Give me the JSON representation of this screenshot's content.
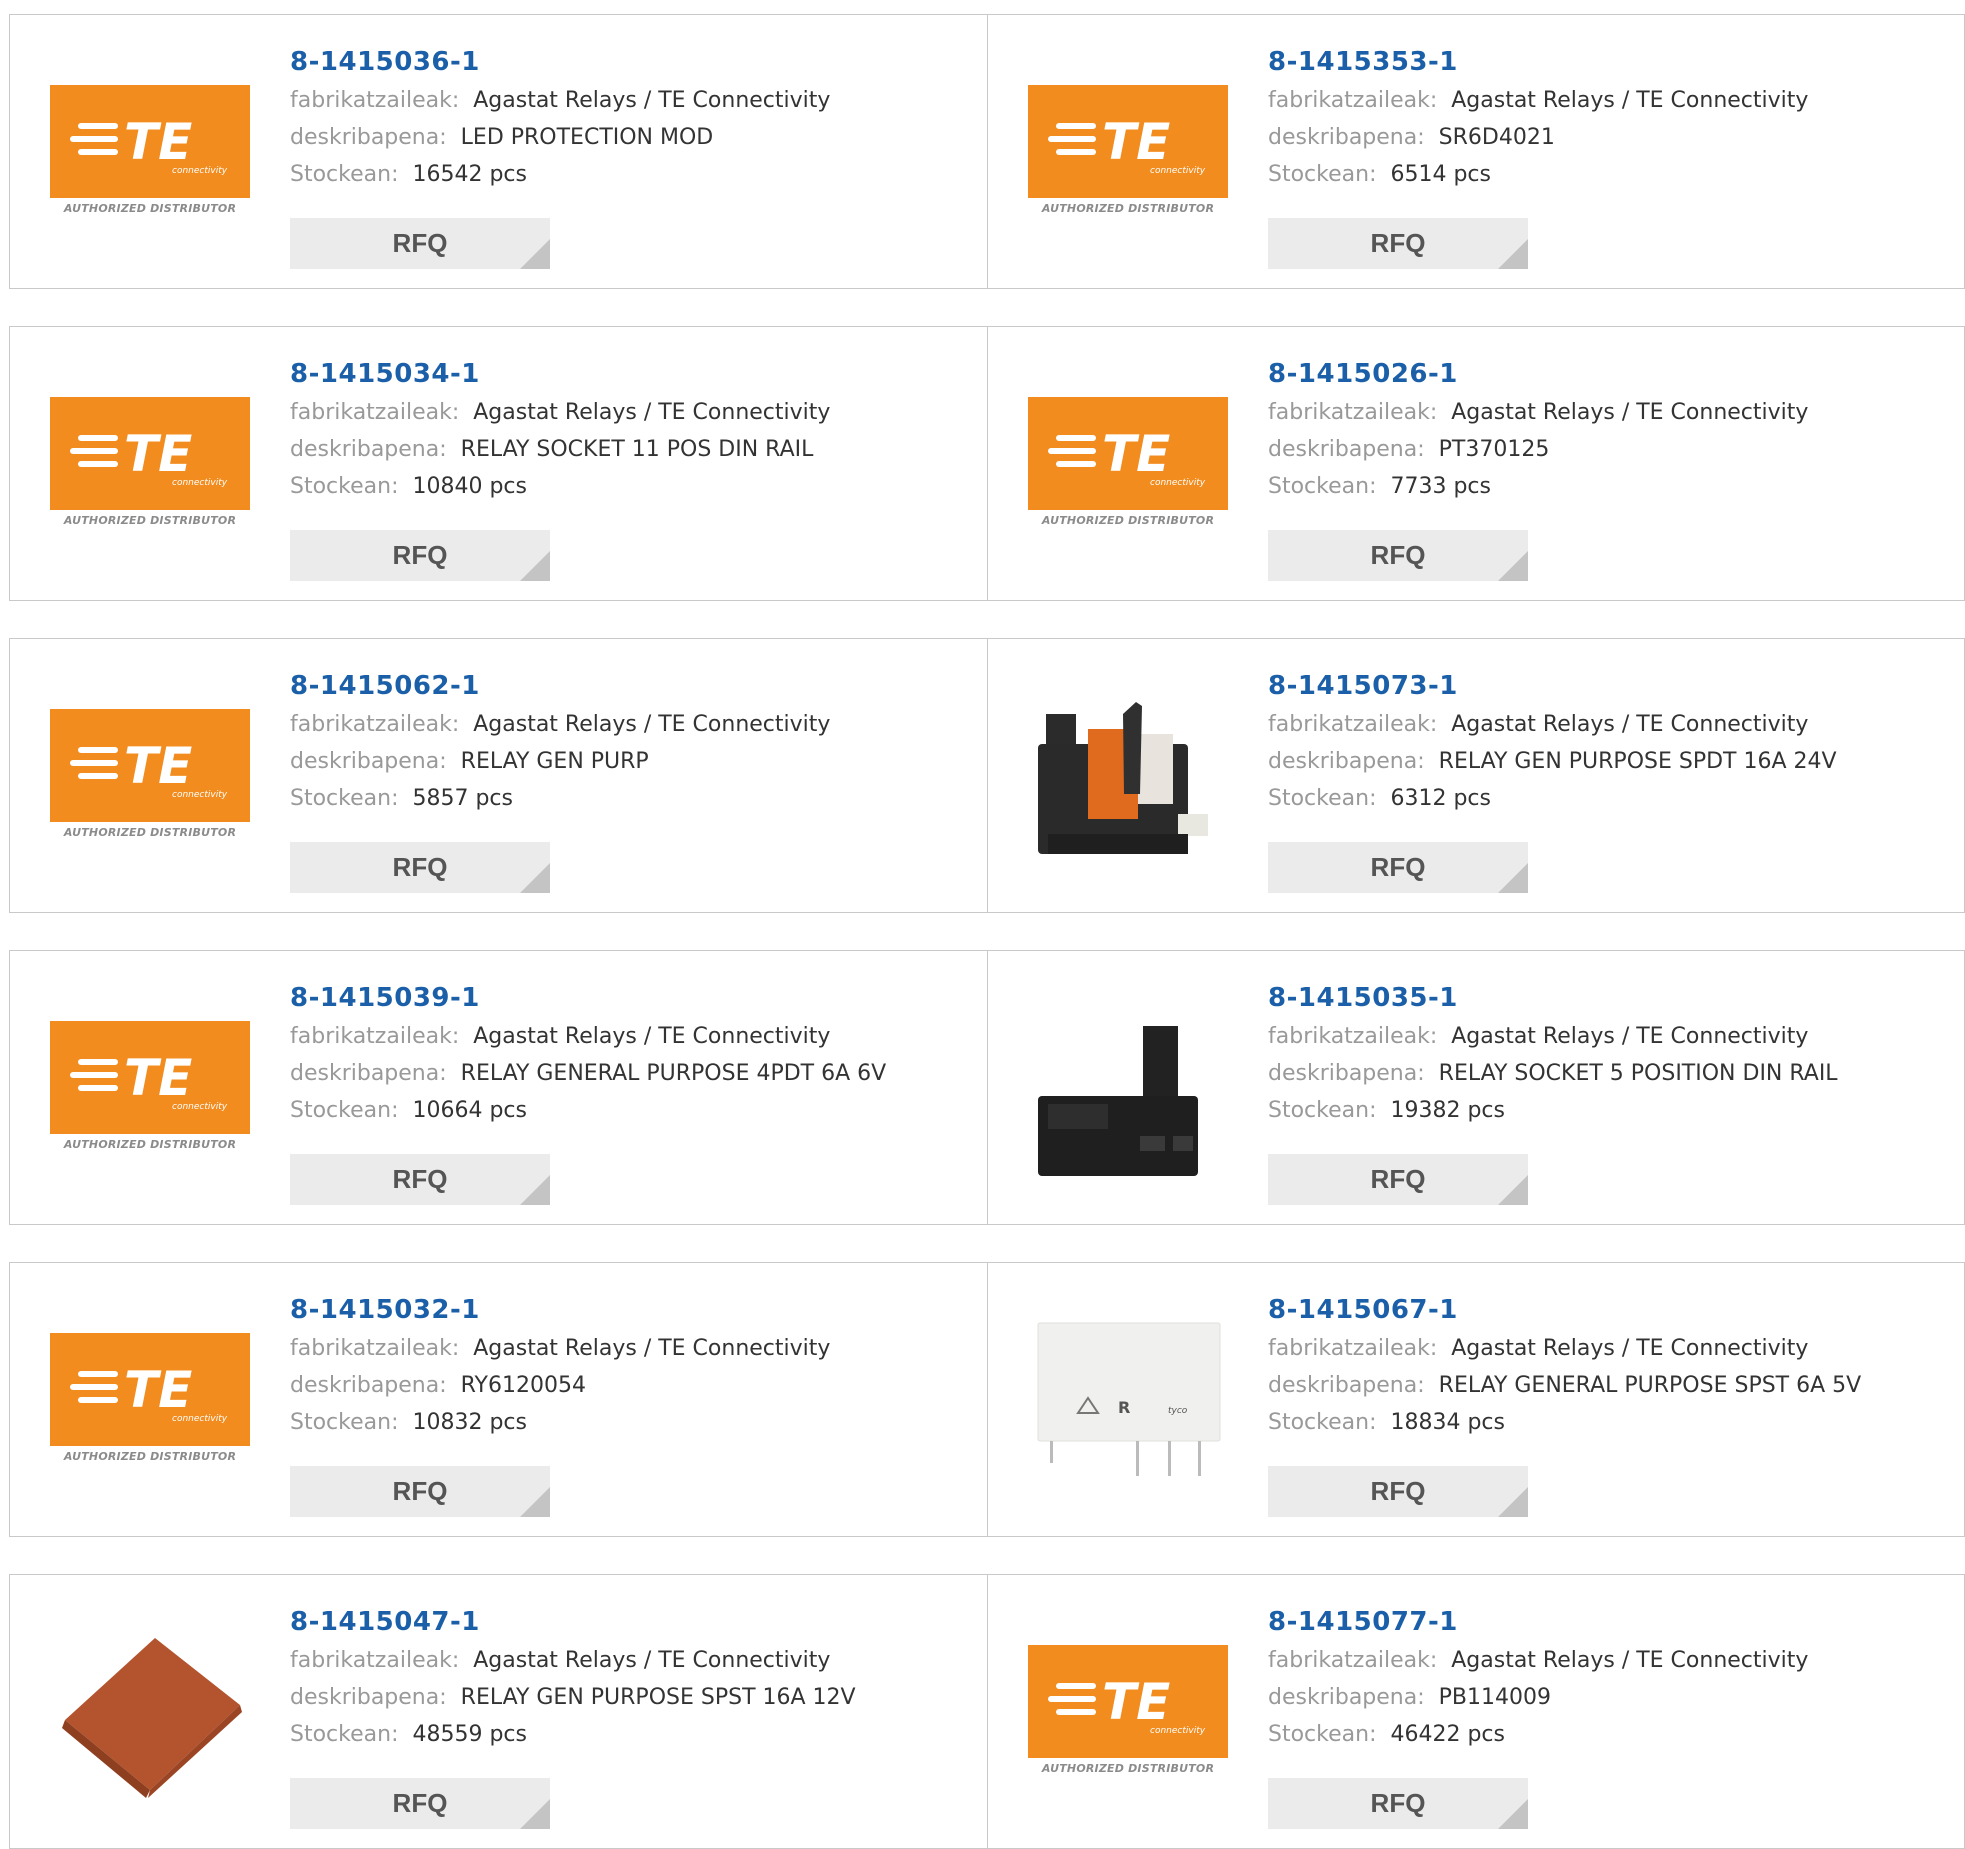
{
  "labels": {
    "manufacturer": "fabrikatzaileak:",
    "description": "deskribapena:",
    "stock": "Stockean:",
    "rfq": "RFQ"
  },
  "logo": {
    "brand_text": "TE",
    "sub_text": "connectivity",
    "tag_text": "AUTHORIZED DISTRIBUTOR",
    "brand_color": "#f28c1e"
  },
  "colors": {
    "link": "#1a5fa8",
    "label": "#999999",
    "value": "#333333",
    "button_bg": "#ebebeb"
  },
  "products": [
    {
      "part_number": "8-1415036-1",
      "manufacturer": "Agastat Relays / TE Connectivity",
      "description": "LED PROTECTION MOD",
      "stock": "16542 pcs",
      "image": "te-logo"
    },
    {
      "part_number": "8-1415353-1",
      "manufacturer": "Agastat Relays / TE Connectivity",
      "description": "SR6D4021",
      "stock": "6514 pcs",
      "image": "te-logo"
    },
    {
      "part_number": "8-1415034-1",
      "manufacturer": "Agastat Relays / TE Connectivity",
      "description": "RELAY SOCKET 11 POS DIN RAIL",
      "stock": "10840 pcs",
      "image": "te-logo"
    },
    {
      "part_number": "8-1415026-1",
      "manufacturer": "Agastat Relays / TE Connectivity",
      "description": "PT370125",
      "stock": "7733 pcs",
      "image": "te-logo"
    },
    {
      "part_number": "8-1415062-1",
      "manufacturer": "Agastat Relays / TE Connectivity",
      "description": "RELAY GEN PURP",
      "stock": "5857 pcs",
      "image": "te-logo"
    },
    {
      "part_number": "8-1415073-1",
      "manufacturer": "Agastat Relays / TE Connectivity",
      "description": "RELAY GEN PURPOSE SPDT 16A 24V",
      "stock": "6312 pcs",
      "image": "relay-with-socket"
    },
    {
      "part_number": "8-1415039-1",
      "manufacturer": "Agastat Relays / TE Connectivity",
      "description": "RELAY GENERAL PURPOSE 4PDT 6A 6V",
      "stock": "10664 pcs",
      "image": "te-logo"
    },
    {
      "part_number": "8-1415035-1",
      "manufacturer": "Agastat Relays / TE Connectivity",
      "description": "RELAY SOCKET 5 POSITION DIN RAIL",
      "stock": "19382 pcs",
      "image": "din-rail-socket"
    },
    {
      "part_number": "8-1415032-1",
      "manufacturer": "Agastat Relays / TE Connectivity",
      "description": "RY6120054",
      "stock": "10832 pcs",
      "image": "te-logo"
    },
    {
      "part_number": "8-1415067-1",
      "manufacturer": "Agastat Relays / TE Connectivity",
      "description": "RELAY GENERAL PURPOSE SPST 6A 5V",
      "stock": "18834 pcs",
      "image": "white-relay"
    },
    {
      "part_number": "8-1415047-1",
      "manufacturer": "Agastat Relays / TE Connectivity",
      "description": "RELAY GEN PURPOSE SPST 16A 12V",
      "stock": "48559 pcs",
      "image": "brown-relay"
    },
    {
      "part_number": "8-1415077-1",
      "manufacturer": "Agastat Relays / TE Connectivity",
      "description": "PB114009",
      "stock": "46422 pcs",
      "image": "te-logo"
    }
  ]
}
